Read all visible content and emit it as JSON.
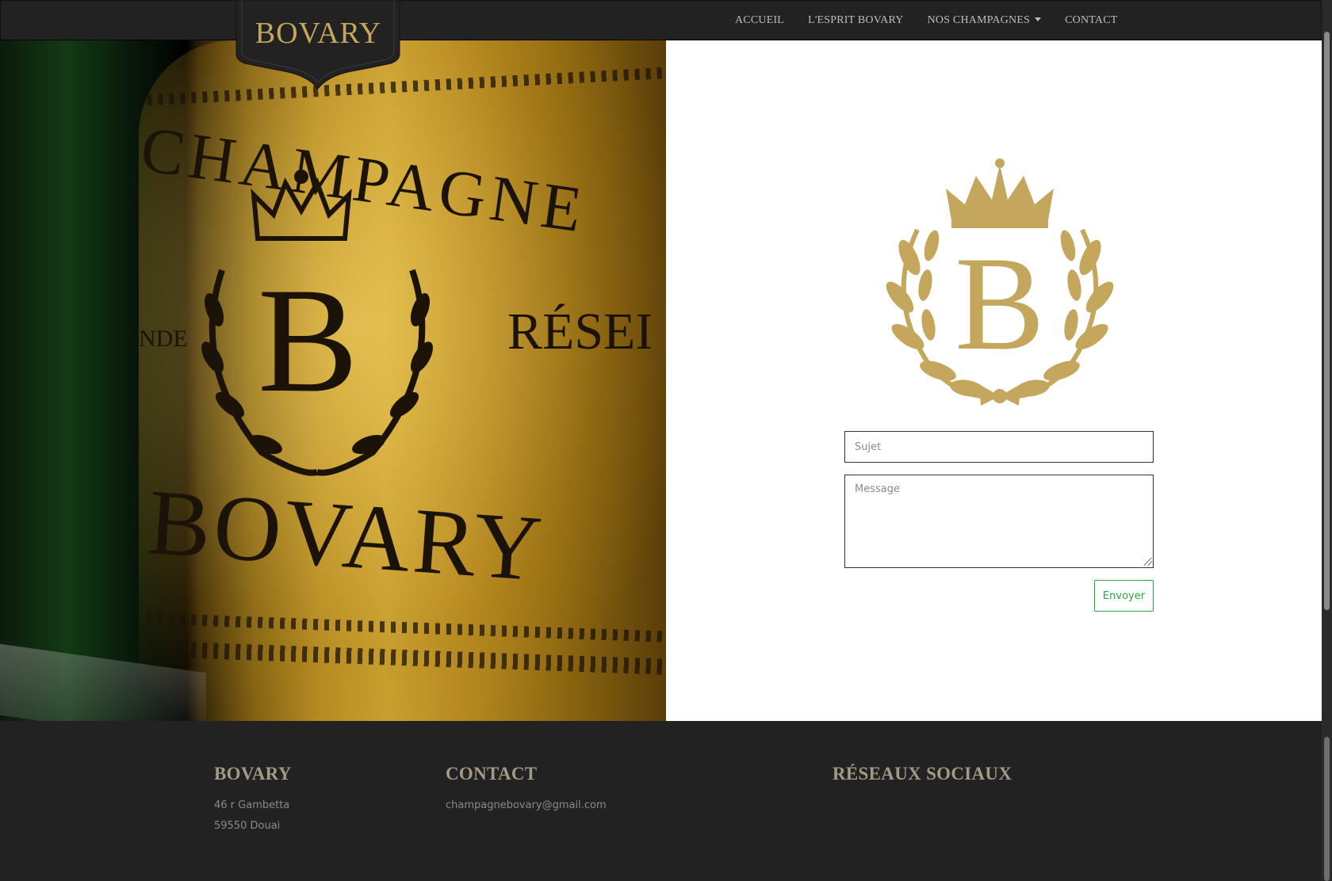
{
  "brand": {
    "name": "BOVARY",
    "gold": "#c4a65c"
  },
  "nav": {
    "items": [
      {
        "label": "ACCUEIL"
      },
      {
        "label": "L'ESPRIT BOVARY"
      },
      {
        "label": "NOS CHAMPAGNES"
      },
      {
        "label": "CONTACT"
      }
    ]
  },
  "hero": {
    "label_champagne": "CHAMPAGNE",
    "label_monogram": "B",
    "label_reserve": "RÉSEI",
    "label_de": "NDE",
    "label_bovary": "BOVARY"
  },
  "crest": {
    "monogram": "B"
  },
  "form": {
    "subject_placeholder": "Sujet",
    "message_placeholder": "Message",
    "submit_label": "Envoyer",
    "accent": "#28a745"
  },
  "footer": {
    "brand_title": "BOVARY",
    "address_line1": "46 r Gambetta",
    "address_line2": "59550 Douai",
    "contact_title": "CONTACT",
    "email": "champagnebovary@gmail.com",
    "social_title": "RÉSEAUX SOCIAUX"
  }
}
